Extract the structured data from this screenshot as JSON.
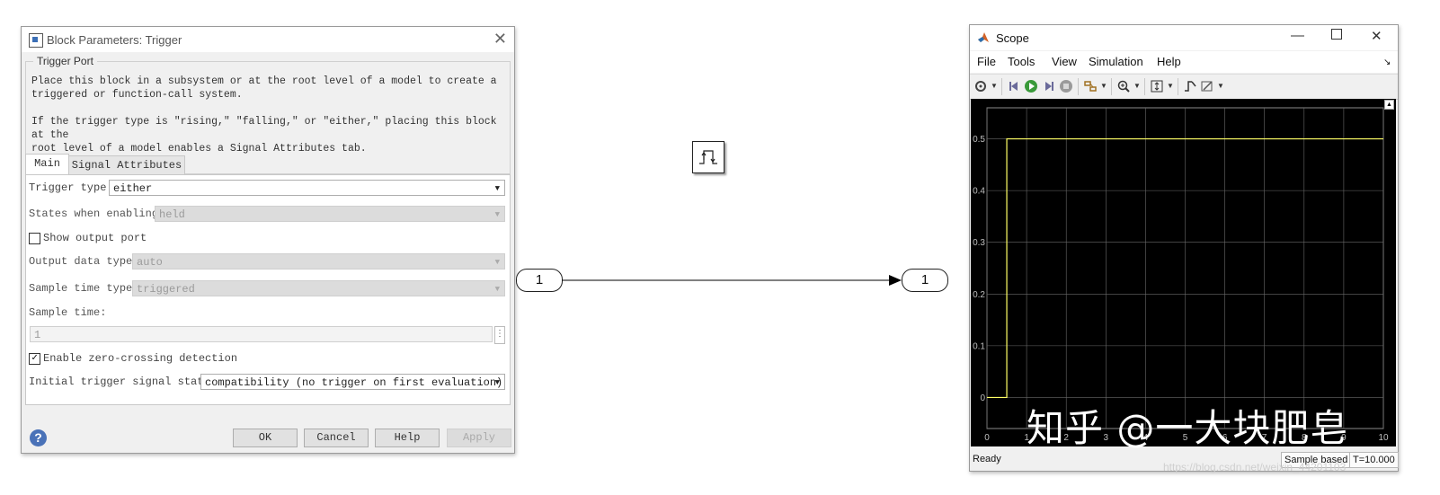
{
  "dialog": {
    "title": "Block Parameters: Trigger",
    "group_title": "Trigger Port",
    "description_1": "Place this block in a subsystem or at the root level of a model to create a\ntriggered or function-call system.",
    "description_2": "If the trigger type is \"rising,\" \"falling,\" or \"either,\" placing this block at the\nroot level of a model enables a Signal Attributes tab.",
    "tabs": [
      {
        "label": "Main",
        "active": true
      },
      {
        "label": "Signal Attributes",
        "active": false
      }
    ],
    "fields": {
      "trigger_type": {
        "label": "Trigger type:",
        "value": "either"
      },
      "states_when_enabling": {
        "label": "States when enabling:",
        "value": "held"
      },
      "show_output_port": {
        "label": "Show output port",
        "checked": false
      },
      "output_data_type": {
        "label": "Output data type:",
        "value": "auto"
      },
      "sample_time_type": {
        "label": "Sample time type:",
        "value": "triggered"
      },
      "sample_time": {
        "label": "Sample time:",
        "value": "1"
      },
      "zero_crossing": {
        "label": "Enable zero-crossing detection",
        "checked": true
      },
      "initial_trigger": {
        "label": "Initial trigger signal state:",
        "value": "compatibility (no trigger on first evaluation)"
      }
    },
    "buttons": {
      "ok": "OK",
      "cancel": "Cancel",
      "help": "Help",
      "apply": "Apply"
    },
    "help_icon": "question-circle-icon"
  },
  "canvas": {
    "inport_label": "1",
    "outport_label": "1",
    "trigger_block_icon": "trigger-edge-icon"
  },
  "scope": {
    "title": "Scope",
    "menu": [
      "File",
      "Tools",
      "View",
      "Simulation",
      "Help"
    ],
    "toolbar_icons": [
      "settings-icon",
      "step-back-icon",
      "run-icon",
      "step-forward-icon",
      "stop-icon",
      "highlight-block-icon",
      "zoom-icon",
      "scale-axes-icon",
      "triggers-icon",
      "measurements-icon"
    ],
    "status": {
      "ready": "Ready",
      "sample_based": "Sample based",
      "time": "T=10.000"
    },
    "colors": {
      "background": "#000000",
      "grid": "#6a6a6a",
      "signal": "#ffff66",
      "tick_label": "#bfbfbf"
    }
  },
  "watermarks": {
    "zhihu": "知乎 @一大块肥皂",
    "url": "https://blog.csdn.net/weixin_44201103"
  },
  "chart_data": {
    "type": "line",
    "title": "",
    "xlabel": "",
    "ylabel": "",
    "xlim": [
      0,
      10
    ],
    "ylim": [
      -0.06,
      0.56
    ],
    "xticks": [
      "0",
      "1",
      "2",
      "3",
      "4",
      "5",
      "6",
      "7",
      "8",
      "9",
      "10"
    ],
    "yticks": [
      "0",
      "0.1",
      "0.2",
      "0.3",
      "0.4",
      "0.5"
    ],
    "grid": true,
    "series": [
      {
        "x": [
          0,
          0.5,
          0.5,
          10
        ],
        "y": [
          0,
          0,
          0.5,
          0.5
        ]
      }
    ]
  }
}
